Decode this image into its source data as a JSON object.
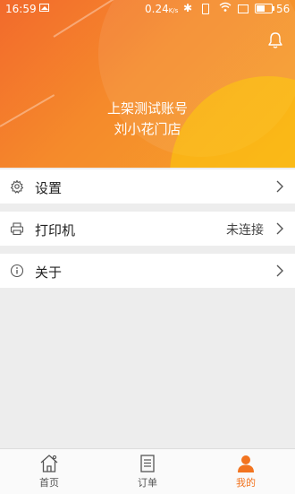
{
  "status_bar": {
    "time": "16:59",
    "speed": "0.24",
    "speed_unit": "K/s",
    "battery": "56",
    "battery_level": 0.56
  },
  "header": {
    "account_name": "上架测试账号",
    "store_name": "刘小花门店"
  },
  "menu": {
    "settings": {
      "label": "设置"
    },
    "printer": {
      "label": "打印机",
      "value": "未连接"
    },
    "about": {
      "label": "关于"
    }
  },
  "tabbar": {
    "home": "首页",
    "orders": "订单",
    "mine": "我的"
  },
  "colors": {
    "accent": "#f27420",
    "header_start": "#f26a2c",
    "header_end": "#f6a22a",
    "background": "#ededed"
  },
  "icons": {
    "notification": "bell-icon",
    "settings": "gear-icon",
    "printer": "printer-icon",
    "about": "info-icon",
    "chevron": "chevron-right-icon",
    "home": "home-icon",
    "orders": "document-icon",
    "mine": "user-icon"
  }
}
